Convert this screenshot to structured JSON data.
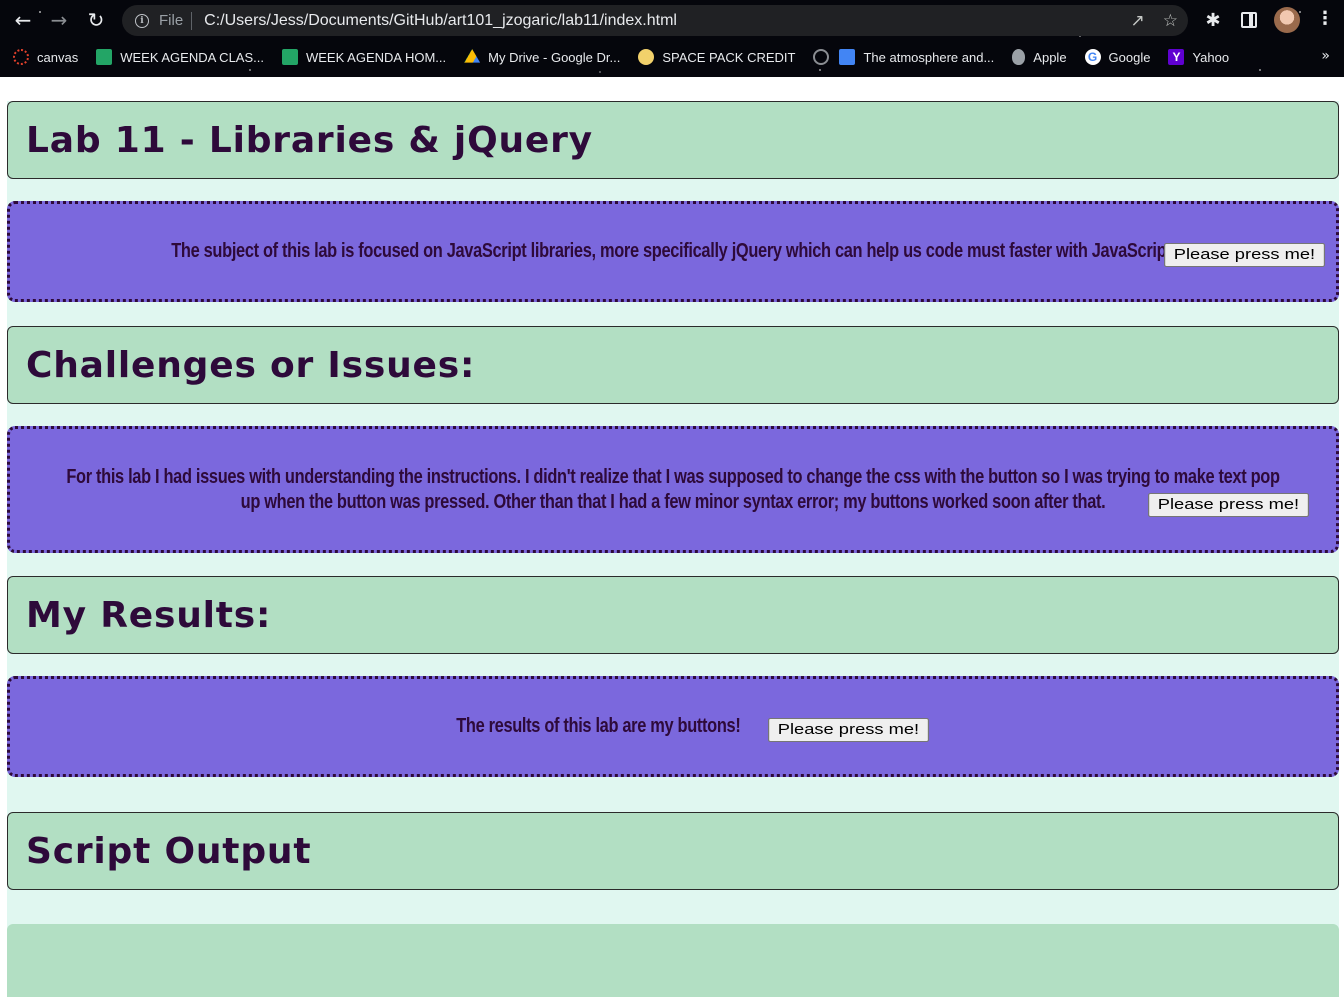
{
  "browser": {
    "omnibox": {
      "scheme_label": "File",
      "url": "C:/Users/Jess/Documents/GitHub/art101_jzogaric/lab11/index.html"
    },
    "bookmarks": [
      {
        "label": "canvas",
        "icon": "canvas-icon",
        "color": "#e2412c"
      },
      {
        "label": "WEEK AGENDA CLAS...",
        "icon": "google-sheets-icon",
        "color": "#23a566"
      },
      {
        "label": "WEEK AGENDA HOM...",
        "icon": "google-sheets-icon",
        "color": "#23a566"
      },
      {
        "label": "My Drive - Google Dr...",
        "icon": "google-drive-icon",
        "color": "#fbbc04"
      },
      {
        "label": "SPACE PACK CREDIT",
        "icon": "character-icon",
        "color": "#f2d16b"
      },
      {
        "label": "",
        "icon": "globe-icon",
        "color": "#8a8d92"
      },
      {
        "label": "The atmosphere and...",
        "icon": "google-docs-icon",
        "color": "#4285f4"
      },
      {
        "label": "Apple",
        "icon": "apple-icon",
        "color": "#9aa0a6"
      },
      {
        "label": "Google",
        "icon": "google-icon",
        "color": "#ffffff"
      },
      {
        "label": "Yahoo",
        "icon": "yahoo-icon",
        "color": "#5f01d1"
      }
    ],
    "more_bookmarks": "»"
  },
  "page": {
    "title": "Lab 11 - Libraries & jQuery",
    "intro": "The subject of this lab is focused on JavaScript libraries, more specifically jQuery which can help us code must faster with JavaScript.",
    "challenges_heading": "Challenges or Issues:",
    "challenges": "For this lab I had issues with understanding the instructions. I didn't realize that I was supposed to change the css with the button so I was trying to make text pop up when the button was pressed. Other than that I had a few minor syntax error; my buttons worked soon after that.",
    "results_heading": "My Results:",
    "results": "The results of this lab are my buttons!",
    "output_heading": "Script Output",
    "button_label": "Please press me!"
  },
  "colors": {
    "heading_bg": "#b2dfc3",
    "paragraph_bg": "#7b68dd",
    "text": "#2e0a3a",
    "page_bg": "#e0f7f0"
  }
}
